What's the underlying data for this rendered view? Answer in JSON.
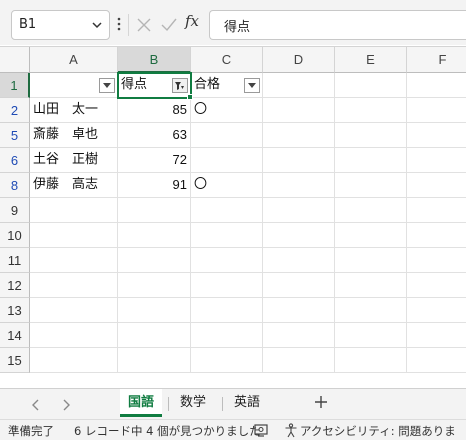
{
  "formula_bar": {
    "name_box": "B1",
    "fx": "fx",
    "formula": "得点"
  },
  "columns": [
    "A",
    "B",
    "C",
    "D",
    "E",
    "F"
  ],
  "selected_column": "B",
  "visible_rows": [
    "1",
    "2",
    "5",
    "6",
    "8",
    "9",
    "10",
    "11",
    "12",
    "13",
    "14",
    "15"
  ],
  "filtered_rows": [
    "2",
    "5",
    "6"
  ],
  "cells": {
    "B1": "得点",
    "C1": "合格",
    "A2": "山田　太一",
    "B2": "85",
    "C2": "〇",
    "A5": "斎藤　卓也",
    "B5": "63",
    "A6": "土谷　正樹",
    "B6": "72",
    "A8": "伊藤　高志",
    "B8": "91",
    "C8": "〇"
  },
  "sheets": [
    "国語",
    "数学",
    "英語"
  ],
  "active_sheet": "国語",
  "add_sheet": "+",
  "status": {
    "ready": "準備完了",
    "filter_result": "6 レコード中 4 個が見つかりました",
    "accessibility": "アクセシビリティ: 問題ありません"
  },
  "colors": {
    "accent": "#107c41",
    "filtered_row_number": "#1f4bb5"
  }
}
